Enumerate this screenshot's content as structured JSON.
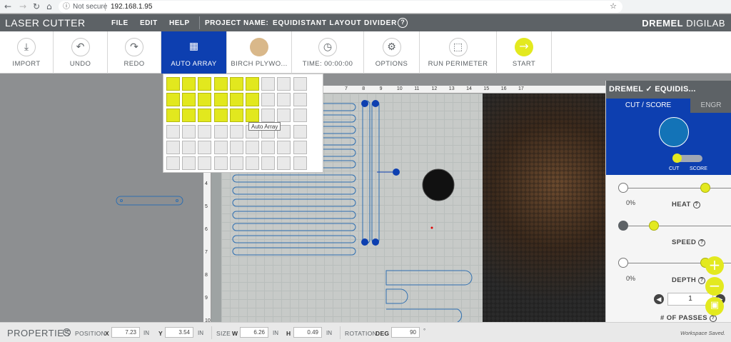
{
  "browser": {
    "back": "←",
    "forward": "→",
    "reload": "↻",
    "home": "⌂",
    "security": "Not secure",
    "url": "192.168.1.95",
    "info_icon": "info-circle-icon",
    "star_icon": "star-icon"
  },
  "header": {
    "brand": "LASER CUTTER",
    "menu": [
      "FILE",
      "EDIT",
      "HELP"
    ],
    "project_label": "PROJECT NAME:",
    "project_name": "EQUIDISTANT LAYOUT DIVIDER",
    "help_glyph": "?",
    "logo_bold": "DREMEL",
    "logo_light": " DIGILAB"
  },
  "toolbar": [
    {
      "label": "IMPORT",
      "icon": "import-icon"
    },
    {
      "label": "UNDO",
      "icon": "undo-icon"
    },
    {
      "label": "REDO",
      "icon": "redo-icon"
    },
    {
      "label": "AUTO ARRAY",
      "icon": "grid-icon"
    },
    {
      "label": "BIRCH PLYWO...",
      "icon": "material-swatch-icon"
    },
    {
      "label": "TIME: 00:00:00",
      "icon": "clock-icon"
    },
    {
      "label": "OPTIONS",
      "icon": "gear-icon"
    },
    {
      "label": "RUN PERIMETER",
      "icon": "perimeter-icon"
    },
    {
      "label": "START",
      "icon": "arrow-right-icon"
    }
  ],
  "auto_array": {
    "columns": 9,
    "rows": 6,
    "selected_columns": 6,
    "selected_rows": 3,
    "tooltip": "Auto Array"
  },
  "rulers": {
    "top_ticks": [
      "7",
      "8",
      "9",
      "10",
      "11",
      "12",
      "13",
      "14",
      "15",
      "16",
      "17"
    ],
    "left_ticks": [
      "4",
      "5",
      "6",
      "7",
      "8",
      "9",
      "10"
    ]
  },
  "panel": {
    "title": "DREMEL ✓ EQUIDIS...",
    "tab_active": "CUT / SCORE",
    "tab_inactive": "ENGR",
    "cut_label": "CUT",
    "score_label": "SCORE",
    "cut_color": "#1373b7",
    "heat": {
      "label": "HEAT",
      "min": "0%"
    },
    "speed": {
      "label": "SPEED"
    },
    "depth": {
      "label": "DEPTH",
      "min": "0%"
    },
    "passes": {
      "label": "# OF PASSES",
      "value": "1"
    }
  },
  "properties": {
    "title": "PROPERTIES",
    "position_label": "POSITION",
    "x_label": "X",
    "x_value": "7.23",
    "x_unit": "IN",
    "y_label": "Y",
    "y_value": "3.54",
    "y_unit": "IN",
    "size_label": "SIZE",
    "w_label": "W",
    "w_value": "6.26",
    "w_unit": "IN",
    "h_label": "H",
    "h_value": "0.49",
    "h_unit": "IN",
    "rotation_label": "ROTATION",
    "deg_label": "DEG",
    "deg_value": "90",
    "deg_unit": "°",
    "status": "Workspace Saved."
  },
  "colors": {
    "accent_blue": "#0d3fb0",
    "accent_yellow": "#e3e91f",
    "header_gray": "#5d6266"
  }
}
